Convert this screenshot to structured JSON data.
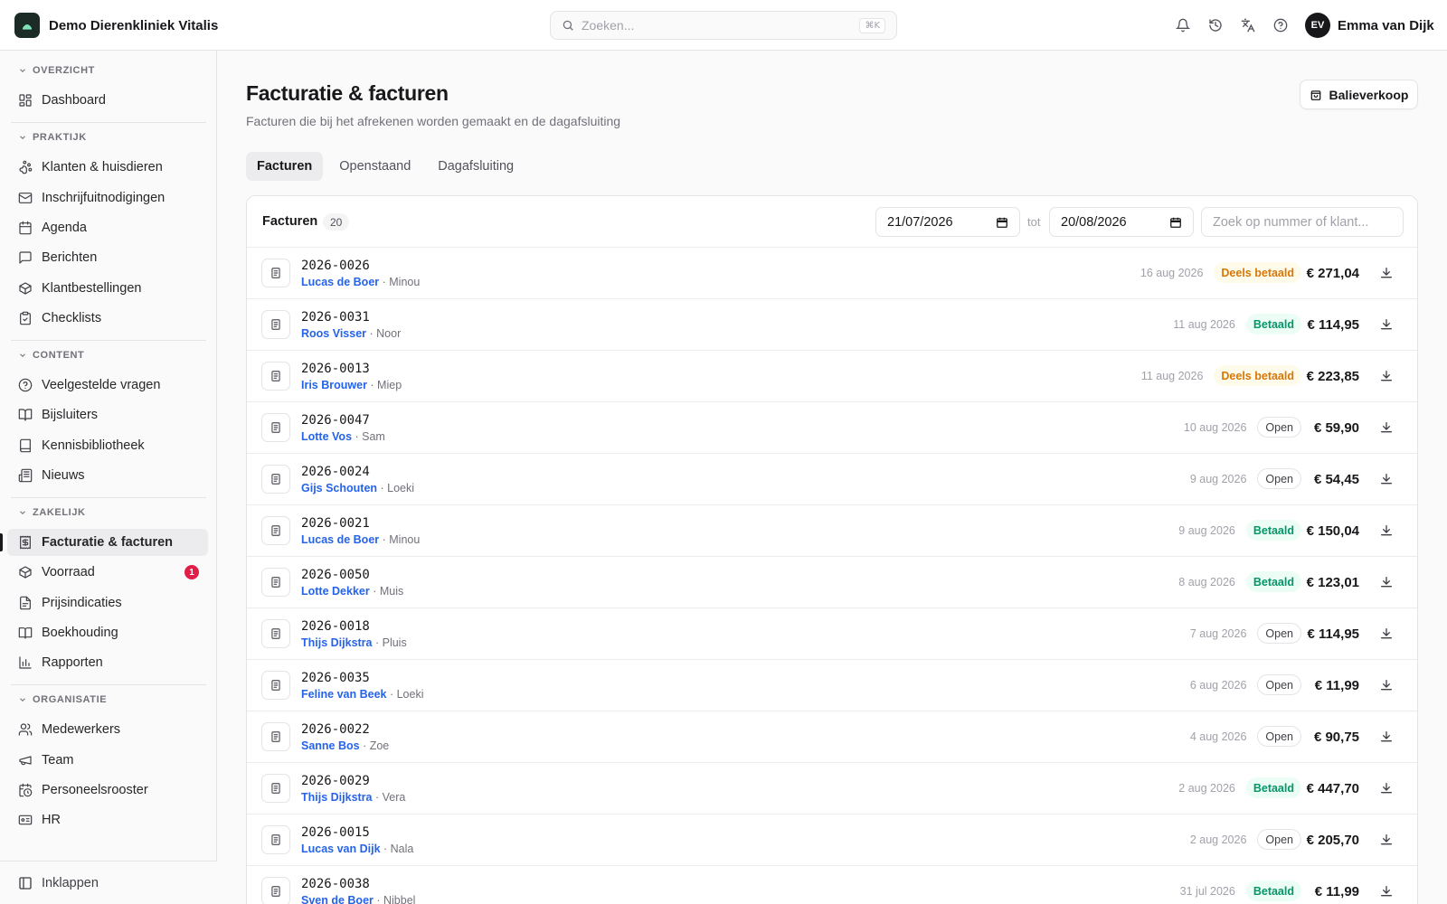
{
  "app": {
    "clinic_name": "Demo Dierenkliniek Vitalis",
    "search_placeholder": "Zoeken...",
    "search_shortcut": "⌘K",
    "user_initials": "EV",
    "user_name": "Emma van Dijk"
  },
  "sidebar": {
    "sections": [
      {
        "label": "OVERZICHT",
        "items": [
          {
            "label": "Dashboard",
            "icon": "dashboard-icon"
          }
        ]
      },
      {
        "label": "PRAKTIJK",
        "items": [
          {
            "label": "Klanten & huisdieren",
            "icon": "paw-icon"
          },
          {
            "label": "Inschrijfuitnodigingen",
            "icon": "mail-icon"
          },
          {
            "label": "Agenda",
            "icon": "calendar-icon"
          },
          {
            "label": "Berichten",
            "icon": "message-icon"
          },
          {
            "label": "Klantbestellingen",
            "icon": "package-icon"
          },
          {
            "label": "Checklists",
            "icon": "clipboard-check-icon"
          }
        ]
      },
      {
        "label": "CONTENT",
        "items": [
          {
            "label": "Veelgestelde vragen",
            "icon": "help-circle-icon"
          },
          {
            "label": "Bijsluiters",
            "icon": "book-open-icon"
          },
          {
            "label": "Kennisbibliotheek",
            "icon": "book-icon"
          },
          {
            "label": "Nieuws",
            "icon": "newspaper-icon"
          }
        ]
      },
      {
        "label": "ZAKELIJK",
        "items": [
          {
            "label": "Facturatie & facturen",
            "icon": "receipt-icon",
            "active": true
          },
          {
            "label": "Voorraad",
            "icon": "package-icon",
            "badge": "1"
          },
          {
            "label": "Prijsindicaties",
            "icon": "file-price-icon"
          },
          {
            "label": "Boekhouding",
            "icon": "ledger-icon"
          },
          {
            "label": "Rapporten",
            "icon": "bar-chart-icon"
          }
        ]
      },
      {
        "label": "ORGANISATIE",
        "items": [
          {
            "label": "Medewerkers",
            "icon": "users-icon"
          },
          {
            "label": "Team",
            "icon": "megaphone-icon"
          },
          {
            "label": "Personeelsrooster",
            "icon": "calendar-clock-icon"
          },
          {
            "label": "HR",
            "icon": "id-card-icon"
          }
        ]
      }
    ],
    "collapse_label": "Inklappen"
  },
  "page": {
    "title": "Facturatie & facturen",
    "subtitle": "Facturen die bij het afrekenen worden gemaakt en de dagafsluiting",
    "counter_sale_label": "Balieverkoop",
    "tabs": [
      {
        "label": "Facturen",
        "active": true
      },
      {
        "label": "Openstaand",
        "active": false
      },
      {
        "label": "Dagafsluiting",
        "active": false
      }
    ]
  },
  "invoices": {
    "title": "Facturen",
    "count": "20",
    "date_from": "21/07/2026",
    "date_to": "20/08/2026",
    "range_sep": "tot",
    "search_placeholder": "Zoek op nummer of klant...",
    "rows": [
      {
        "number": "2026-0026",
        "customer": "Lucas de Boer",
        "pet": "Minou",
        "date": "16 aug 2026",
        "status": "Deels betaald",
        "status_type": "partial",
        "amount": "€ 271,04"
      },
      {
        "number": "2026-0031",
        "customer": "Roos Visser",
        "pet": "Noor",
        "date": "11 aug 2026",
        "status": "Betaald",
        "status_type": "paid",
        "amount": "€ 114,95"
      },
      {
        "number": "2026-0013",
        "customer": "Iris Brouwer",
        "pet": "Miep",
        "date": "11 aug 2026",
        "status": "Deels betaald",
        "status_type": "partial",
        "amount": "€ 223,85"
      },
      {
        "number": "2026-0047",
        "customer": "Lotte Vos",
        "pet": "Sam",
        "date": "10 aug 2026",
        "status": "Open",
        "status_type": "open",
        "amount": "€ 59,90"
      },
      {
        "number": "2026-0024",
        "customer": "Gijs Schouten",
        "pet": "Loeki",
        "date": "9 aug 2026",
        "status": "Open",
        "status_type": "open",
        "amount": "€ 54,45"
      },
      {
        "number": "2026-0021",
        "customer": "Lucas de Boer",
        "pet": "Minou",
        "date": "9 aug 2026",
        "status": "Betaald",
        "status_type": "paid",
        "amount": "€ 150,04"
      },
      {
        "number": "2026-0050",
        "customer": "Lotte Dekker",
        "pet": "Muis",
        "date": "8 aug 2026",
        "status": "Betaald",
        "status_type": "paid",
        "amount": "€ 123,01"
      },
      {
        "number": "2026-0018",
        "customer": "Thijs Dijkstra",
        "pet": "Pluis",
        "date": "7 aug 2026",
        "status": "Open",
        "status_type": "open",
        "amount": "€ 114,95"
      },
      {
        "number": "2026-0035",
        "customer": "Feline van Beek",
        "pet": "Loeki",
        "date": "6 aug 2026",
        "status": "Open",
        "status_type": "open",
        "amount": "€ 11,99"
      },
      {
        "number": "2026-0022",
        "customer": "Sanne Bos",
        "pet": "Zoe",
        "date": "4 aug 2026",
        "status": "Open",
        "status_type": "open",
        "amount": "€ 90,75"
      },
      {
        "number": "2026-0029",
        "customer": "Thijs Dijkstra",
        "pet": "Vera",
        "date": "2 aug 2026",
        "status": "Betaald",
        "status_type": "paid",
        "amount": "€ 447,70"
      },
      {
        "number": "2026-0015",
        "customer": "Lucas van Dijk",
        "pet": "Nala",
        "date": "2 aug 2026",
        "status": "Open",
        "status_type": "open",
        "amount": "€ 205,70"
      },
      {
        "number": "2026-0038",
        "customer": "Sven de Boer",
        "pet": "Nibbel",
        "date": "31 jul 2026",
        "status": "Betaald",
        "status_type": "paid",
        "amount": "€ 11,99"
      }
    ]
  }
}
